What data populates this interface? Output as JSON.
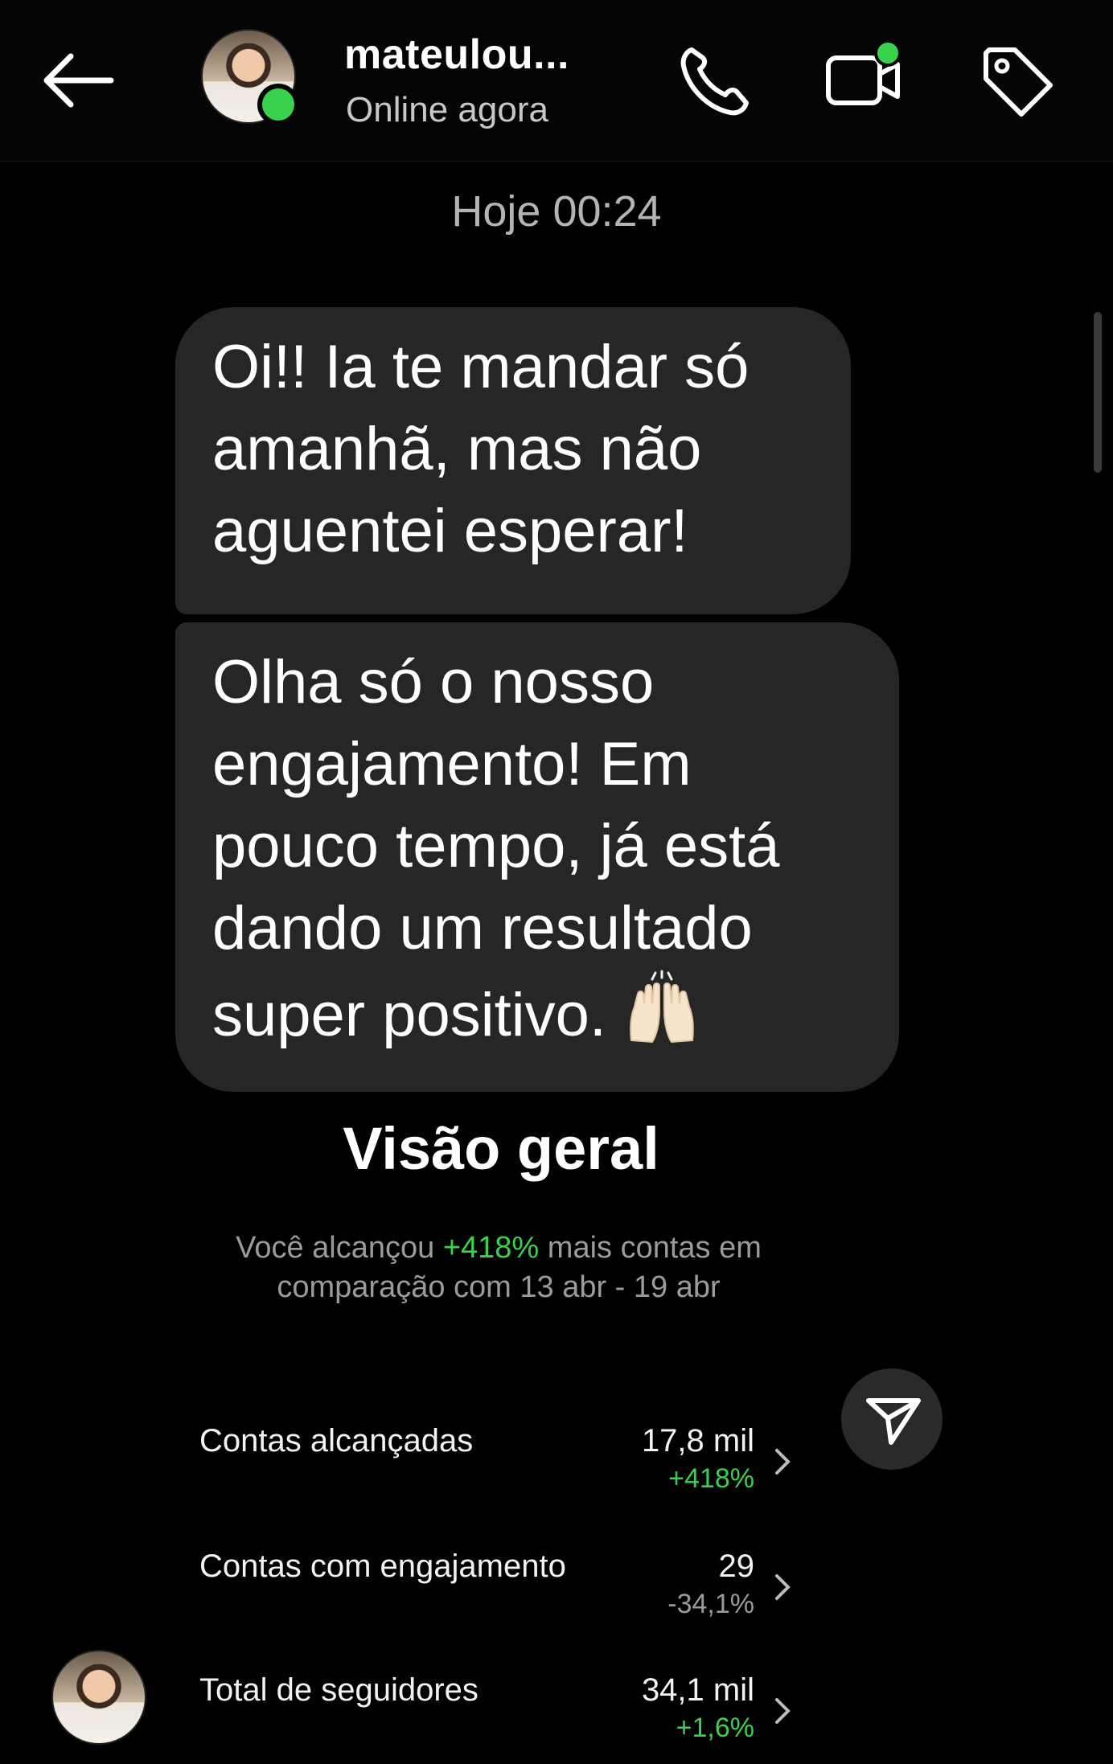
{
  "header": {
    "username": "mateulou...",
    "status": "Online agora",
    "icons": [
      "back-arrow-icon",
      "phone-icon",
      "video-call-icon",
      "tag-icon"
    ],
    "online_color": "#3ad14c"
  },
  "chat": {
    "timestamp": "Hoje 00:24",
    "messages": [
      {
        "text": "Oi!! Ia te mandar só amanhã, mas não aguentei esperar!"
      },
      {
        "text": "Olha só o nosso engajamento! Em pouco tempo, já está dando um resultado super positivo.",
        "emoji": "raising-hands-emoji"
      }
    ]
  },
  "insights": {
    "title": "Visão geral",
    "desc_prefix": "Você alcançou ",
    "desc_highlight": "+418%",
    "desc_suffix": " mais contas em comparação com 13 abr - 19 abr",
    "metrics": [
      {
        "label": "Contas alcançadas",
        "value": "17,8 mil",
        "change": "+418%"
      },
      {
        "label": "Contas com engajamento",
        "value": "29",
        "change": "-34,1%"
      },
      {
        "label": "Total de seguidores",
        "value": "34,1 mil",
        "change": "+1,6%"
      }
    ]
  },
  "colors": {
    "bubble": "#262626",
    "background": "#000000",
    "positive": "#3ad14c"
  }
}
